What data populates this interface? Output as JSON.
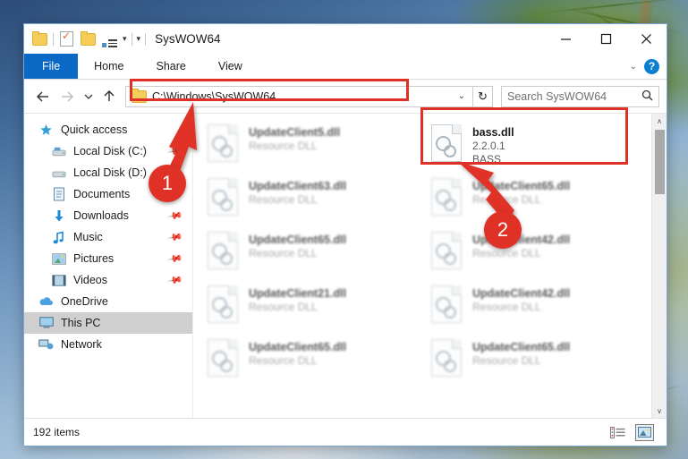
{
  "window": {
    "title": "SysWOW64",
    "quick_access_toolbar": [
      {
        "name": "folder-icon",
        "label": "Folder"
      },
      {
        "name": "properties-icon",
        "label": "Properties"
      },
      {
        "name": "new-folder-icon",
        "label": "New folder"
      },
      {
        "name": "customize-icon",
        "label": "Customize Quick Access Toolbar"
      },
      {
        "name": "chevron-down-icon",
        "label": "More"
      }
    ],
    "controls": {
      "minimize": "—",
      "maximize": "□",
      "close": "✕"
    }
  },
  "ribbon": {
    "tabs": [
      {
        "label": "File",
        "active": true
      },
      {
        "label": "Home",
        "active": false
      },
      {
        "label": "Share",
        "active": false
      },
      {
        "label": "View",
        "active": false
      }
    ],
    "collapse_label": "⌄",
    "help_label": "?"
  },
  "navbar": {
    "back_label": "←",
    "forward_label": "→",
    "recent_label": "⌄",
    "up_label": "↑",
    "address_path": "C:\\Windows\\SysWOW64",
    "address_dropdown": "⌄",
    "refresh_label": "↻",
    "search_placeholder": "Search SysWOW64",
    "search_icon": "⌕"
  },
  "sidebar": {
    "items": [
      {
        "label": "Quick access",
        "icon": "star-icon",
        "indent": false,
        "pinned": false,
        "selected": false
      },
      {
        "label": "Local Disk (C:)",
        "icon": "drive-icon",
        "indent": true,
        "pinned": true,
        "selected": false
      },
      {
        "label": "Local Disk (D:)",
        "icon": "drive-icon",
        "indent": true,
        "pinned": true,
        "selected": false
      },
      {
        "label": "Documents",
        "icon": "documents-icon",
        "indent": true,
        "pinned": true,
        "selected": false
      },
      {
        "label": "Downloads",
        "icon": "downloads-icon",
        "indent": true,
        "pinned": true,
        "selected": false
      },
      {
        "label": "Music",
        "icon": "music-icon",
        "indent": true,
        "pinned": true,
        "selected": false
      },
      {
        "label": "Pictures",
        "icon": "pictures-icon",
        "indent": true,
        "pinned": true,
        "selected": false
      },
      {
        "label": "Videos",
        "icon": "videos-icon",
        "indent": true,
        "pinned": true,
        "selected": false
      },
      {
        "label": "OneDrive",
        "icon": "onedrive-icon",
        "indent": false,
        "pinned": false,
        "selected": false
      },
      {
        "label": "This PC",
        "icon": "thispc-icon",
        "indent": false,
        "pinned": false,
        "selected": true
      },
      {
        "label": "Network",
        "icon": "network-icon",
        "indent": false,
        "pinned": false,
        "selected": false
      }
    ]
  },
  "files": [
    {
      "name": "UpdateClient5.dll",
      "line2": "Resource DLL",
      "line3": "",
      "highlighted": false
    },
    {
      "name": "bass.dll",
      "line2": "2.2.0.1",
      "line3": "BASS",
      "highlighted": true
    },
    {
      "name": "UpdateClient63.dll",
      "line2": "Resource DLL",
      "line3": "",
      "highlighted": false
    },
    {
      "name": "UpdateClient65.dll",
      "line2": "Resource DLL",
      "line3": "",
      "highlighted": false
    },
    {
      "name": "UpdateClient65.dll",
      "line2": "Resource DLL",
      "line3": "",
      "highlighted": false
    },
    {
      "name": "UpdateClient42.dll",
      "line2": "Resource DLL",
      "line3": "",
      "highlighted": false
    },
    {
      "name": "UpdateClient21.dll",
      "line2": "Resource DLL",
      "line3": "",
      "highlighted": false
    },
    {
      "name": "UpdateClient42.dll",
      "line2": "Resource DLL",
      "line3": "",
      "highlighted": false
    },
    {
      "name": "UpdateClient65.dll",
      "line2": "Resource DLL",
      "line3": "",
      "highlighted": false
    },
    {
      "name": "UpdateClient65.dll",
      "line2": "Resource DLL",
      "line3": "",
      "highlighted": false
    }
  ],
  "statusbar": {
    "item_count": "192 items",
    "views": [
      {
        "name": "details-view-icon",
        "label": "Details view",
        "selected": false
      },
      {
        "name": "large-icons-view-icon",
        "label": "Large icons view",
        "selected": true
      }
    ]
  },
  "annotations": {
    "accent_color": "#e03127",
    "badges": [
      {
        "number": "1",
        "target": "address-bar"
      },
      {
        "number": "2",
        "target": "bass-dll-file"
      }
    ]
  },
  "scrollbar": {
    "up_label": "∧",
    "down_label": "∨"
  }
}
